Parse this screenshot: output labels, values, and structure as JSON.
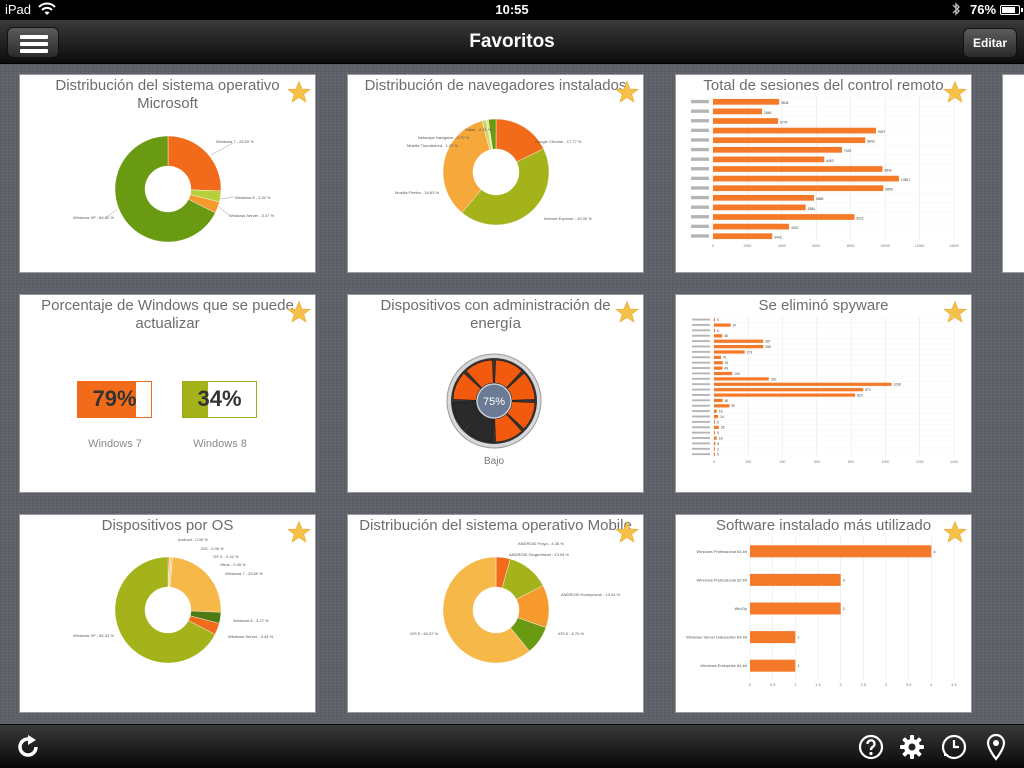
{
  "status": {
    "carrier": "iPad",
    "time": "10:55",
    "battery": "76%",
    "battery_level": 0.76
  },
  "nav": {
    "title": "Favoritos",
    "edit_label": "Editar"
  },
  "colors": {
    "orange": "#f26b1b",
    "green": "#6a9a12",
    "light_orange": "#f7a83a",
    "olive": "#a4b319",
    "star": "#f5c14a"
  },
  "cards": [
    {
      "title": "Distribución del sistema operativo Microsoft",
      "labels": [
        "Windows 7 - 25.29 %",
        "Windows 8 - 3.32 %",
        "Windows Server - 3.47 %",
        "Windows XP - 66.82 %"
      ]
    },
    {
      "title": "Distribución de navegadores instalados",
      "labels": [
        "Safari - 2.31 %",
        "Netscape Navigator - 0.70 %",
        "Mozilla Thunderbird - 1.29 %",
        "Mozilla Firefox - 34.63 %",
        "Google Chrome - 17.77 %",
        "Internet Explorer - 43.30 %"
      ]
    },
    {
      "title": "Total de sesiones del control remoto",
      "bar_labels": [
        "3844",
        "2848",
        "3779",
        "9467",
        "8843",
        "7492",
        "6463",
        "9842",
        "10801",
        "9895",
        "5868",
        "5384",
        "8221",
        "4420",
        "3442"
      ],
      "x_ticks": [
        "0",
        "2000",
        "4000",
        "6000",
        "8000",
        "10000",
        "12000",
        "14000"
      ]
    },
    {
      "title": "Porcentaje de Windows que se puede actualizar",
      "items": [
        {
          "value": "79%",
          "fraction": 0.79,
          "label": "Windows 7"
        },
        {
          "value": "34%",
          "fraction": 0.34,
          "label": "Windows 8"
        }
      ]
    },
    {
      "title": "Dispositivos con administración de energía",
      "gauge_value": "75%",
      "gauge_label": "Bajo"
    },
    {
      "title": "Se eliminó spyware",
      "bar_labels": [
        "5",
        "97",
        "6",
        "48",
        "287",
        "288",
        "179",
        "41",
        "51",
        "49",
        "106",
        "320",
        "1036",
        "871",
        "823",
        "50",
        "90",
        "16",
        "24",
        "6",
        "28",
        "5",
        "16",
        "8",
        "2",
        "5"
      ],
      "x_ticks": [
        "0",
        "200",
        "400",
        "600",
        "800",
        "1000",
        "1200",
        "1400"
      ]
    },
    {
      "title": "Dispositivos por OS",
      "labels": [
        "Android - 0.39 %",
        "iOS - 0.06 %",
        "OS X - 0.42 %",
        "Otros - 0.45 %",
        "Windows 7 - 23.59 %",
        "Windows 8 - 3.27 %",
        "Windows Server - 3.44 %",
        "Windows XP - 65.33 %"
      ]
    },
    {
      "title": "Distribución del sistema operativo Mobile",
      "labels": [
        "ANDROID Froyo - 4.35 %",
        "ANDROID Gingerbread - 13.04 %",
        "ANDROID Honeycomb - 13.04 %",
        "iOS 6 - 8.70 %",
        "iOS 5 - 60.87 %"
      ]
    },
    {
      "title": "Software instalado más utilizado",
      "categories": [
        "Windows Professional 64-bit",
        "Windows Professional 32-bit",
        "WinZip",
        "Windows Server Datacenter 64-bit",
        "Windows Enterprise 64-bit"
      ],
      "values": [
        4,
        2,
        2,
        1,
        1
      ],
      "x_ticks": [
        "0",
        "0.5",
        "1",
        "1.5",
        "2",
        "2.5",
        "3",
        "3.5",
        "4",
        "4.5"
      ]
    }
  ]
}
